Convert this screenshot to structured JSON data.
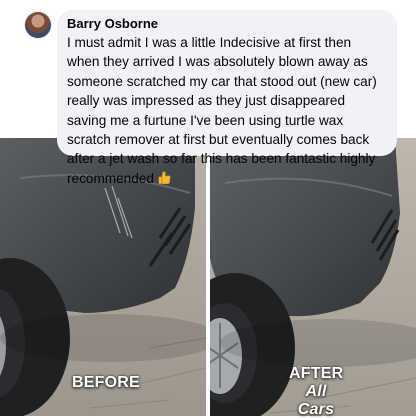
{
  "comment": {
    "author": "Barry Osborne",
    "text": "I must admit I was a little Indecisive at first then when they arrived I was absolutely blown away as someone scratched my car that stood out (new car) really was impressed as they just disappeared saving me a furtune I've been using turtle wax scratch remover at first but eventually comes back after a jet wash so far this has been fantastic highly recommended",
    "emoji": "thumbs-up-icon"
  },
  "photos": {
    "before_label": "BEFORE",
    "after_label_line1": "AFTER",
    "after_label_line2": "All Cars"
  },
  "colors": {
    "bubble_bg": "#f0f2f5",
    "car_paint": "#4a4d52",
    "tire": "#1f2022",
    "ground": "#a9a39a",
    "thumb": "#f5b82e"
  }
}
